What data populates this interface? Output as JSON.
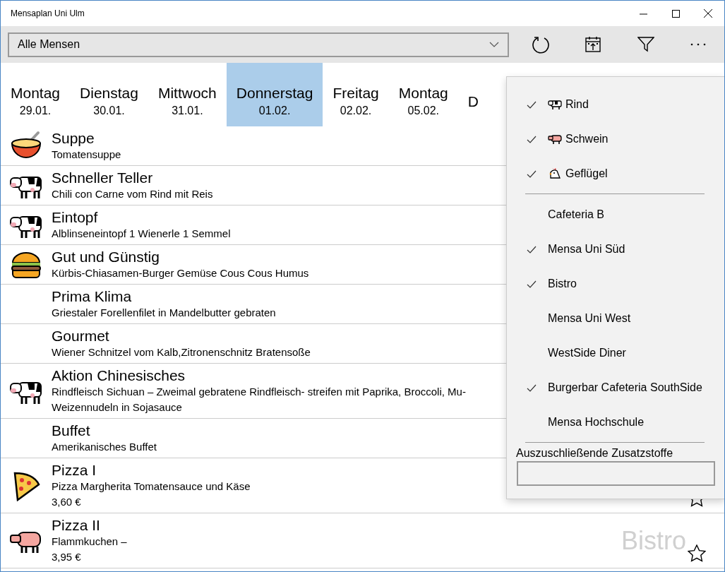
{
  "window": {
    "title": "Mensaplan Uni Ulm"
  },
  "toolbar": {
    "canteen_select": {
      "value": "Alle Mensen"
    }
  },
  "days": [
    {
      "weekday": "Montag",
      "date": "29.01.",
      "selected": false
    },
    {
      "weekday": "Dienstag",
      "date": "30.01.",
      "selected": false
    },
    {
      "weekday": "Mittwoch",
      "date": "31.01.",
      "selected": false
    },
    {
      "weekday": "Donnerstag",
      "date": "01.02.",
      "selected": true
    },
    {
      "weekday": "Freitag",
      "date": "02.02.",
      "selected": false
    },
    {
      "weekday": "Montag",
      "date": "05.02.",
      "selected": false
    },
    {
      "weekday": "D",
      "selected": false
    }
  ],
  "meals": [
    {
      "kind": "soup",
      "title": "Suppe",
      "description": [
        "Tomatensuppe"
      ]
    },
    {
      "kind": "beef",
      "title": "Schneller Teller",
      "description": [
        "Chili con Carne vom Rind mit Reis"
      ]
    },
    {
      "kind": "beef",
      "title": "Eintopf",
      "description": [
        "Alblinseneintopf 1 Wienerle 1 Semmel"
      ]
    },
    {
      "kind": "burger",
      "title": "Gut und Günstig",
      "description": [
        "Kürbis-Chiasamen-Burger Gemüse Cous Cous Humus"
      ]
    },
    {
      "kind": "none",
      "title": "Prima Klima",
      "description": [
        "Griestaler Forellenfilet in Mandelbutter gebraten"
      ]
    },
    {
      "kind": "none",
      "title": "Gourmet",
      "description": [
        "Wiener Schnitzel vom Kalb,Zitronenschnitz Bratensoße"
      ]
    },
    {
      "kind": "beef",
      "title": "Aktion Chinesisches",
      "description": [
        "Rindfleisch Sichuan – Zweimal gebratene Rindfleisch- streifen mit Paprika, Broccoli, Mu-",
        "Weizennudeln in Sojasauce"
      ]
    },
    {
      "kind": "none",
      "title": "Buffet",
      "description": [
        "Amerikanisches Buffet"
      ]
    },
    {
      "kind": "pizza",
      "title": "Pizza I",
      "description": [
        "Pizza Margherita Tomatensauce und Käse"
      ],
      "price": "3,60 €",
      "favorite": false
    },
    {
      "kind": "pork",
      "title": "Pizza II",
      "description": [
        "Flammkuchen –"
      ],
      "price": "3,95 €",
      "location": "Bistro",
      "favorite": false
    }
  ],
  "filter_menu": {
    "meat": [
      {
        "kind": "beef",
        "label": "Rind",
        "checked": true
      },
      {
        "kind": "pork",
        "label": "Schwein",
        "checked": true
      },
      {
        "kind": "poultry",
        "label": "Geflügel",
        "checked": true
      }
    ],
    "canteens": [
      {
        "label": "Cafeteria B",
        "checked": false
      },
      {
        "label": "Mensa Uni Süd",
        "checked": true
      },
      {
        "label": "Bistro",
        "checked": true
      },
      {
        "label": "Mensa Uni West",
        "checked": false
      },
      {
        "label": "WestSide Diner",
        "checked": false
      },
      {
        "label": "Burgerbar Cafeteria SouthSide",
        "checked": true
      },
      {
        "label": "Mensa Hochschule",
        "checked": false
      }
    ],
    "additives": {
      "label": "Auszuschließende Zusatzstoffe"
    }
  }
}
